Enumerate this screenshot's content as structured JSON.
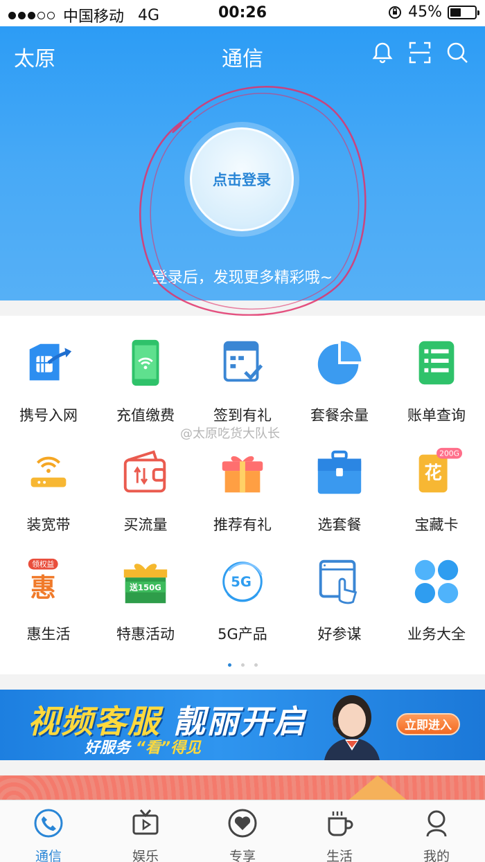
{
  "status_bar": {
    "carrier": "中国移动",
    "network": "4G",
    "time": "00:26",
    "battery": "45%",
    "battery_level": 0.45
  },
  "header": {
    "city": "太原",
    "title": "通信",
    "icons": [
      "bell-icon",
      "scan-icon",
      "search-icon"
    ],
    "login_button": "点击登录",
    "tip": "登录后，发现更多精彩哦~"
  },
  "services": [
    {
      "label": "携号入网",
      "icon": "sim-transfer-icon"
    },
    {
      "label": "充值缴费",
      "icon": "phone-wifi-icon"
    },
    {
      "label": "签到有礼",
      "icon": "checkin-calendar-icon"
    },
    {
      "label": "套餐余量",
      "icon": "pie-chart-icon"
    },
    {
      "label": "账单查询",
      "icon": "bill-list-icon"
    },
    {
      "label": "装宽带",
      "icon": "router-icon"
    },
    {
      "label": "买流量",
      "icon": "data-wallet-icon"
    },
    {
      "label": "推荐有礼",
      "icon": "gift-box-icon"
    },
    {
      "label": "选套餐",
      "icon": "briefcase-icon"
    },
    {
      "label": "宝藏卡",
      "icon": "treasure-card-icon",
      "badge": "200G",
      "glyph": "花"
    },
    {
      "label": "惠生活",
      "icon": "hui-life-icon",
      "badge": "领权益",
      "glyph": "惠"
    },
    {
      "label": "特惠活动",
      "icon": "promo-gift-icon",
      "badge": "送150G"
    },
    {
      "label": "5G产品",
      "icon": "5g-icon",
      "glyph": "5G"
    },
    {
      "label": "好参谋",
      "icon": "advisor-touch-icon"
    },
    {
      "label": "业务大全",
      "icon": "all-services-icon"
    }
  ],
  "watermark": "@太原吃货大队长",
  "pager": {
    "pages": 3,
    "current": 1
  },
  "banner": {
    "title_yellow": "视频客服",
    "title_white": "靓丽开启",
    "subtitle_white": "好服务",
    "subtitle_yellow": "“看”得见",
    "button": "立即进入"
  },
  "tabbar": [
    {
      "label": "通信",
      "icon": "phone-icon",
      "active": true
    },
    {
      "label": "娱乐",
      "icon": "tv-icon",
      "active": false
    },
    {
      "label": "专享",
      "icon": "heart-icon",
      "active": false
    },
    {
      "label": "生活",
      "icon": "cup-icon",
      "active": false
    },
    {
      "label": "我的",
      "icon": "user-icon",
      "active": false
    }
  ],
  "colors": {
    "header_blue": "#2c9cf5",
    "accent_blue": "#2a86d6",
    "banner_yellow": "#ffd93d",
    "annotation_red": "#e0336a"
  }
}
